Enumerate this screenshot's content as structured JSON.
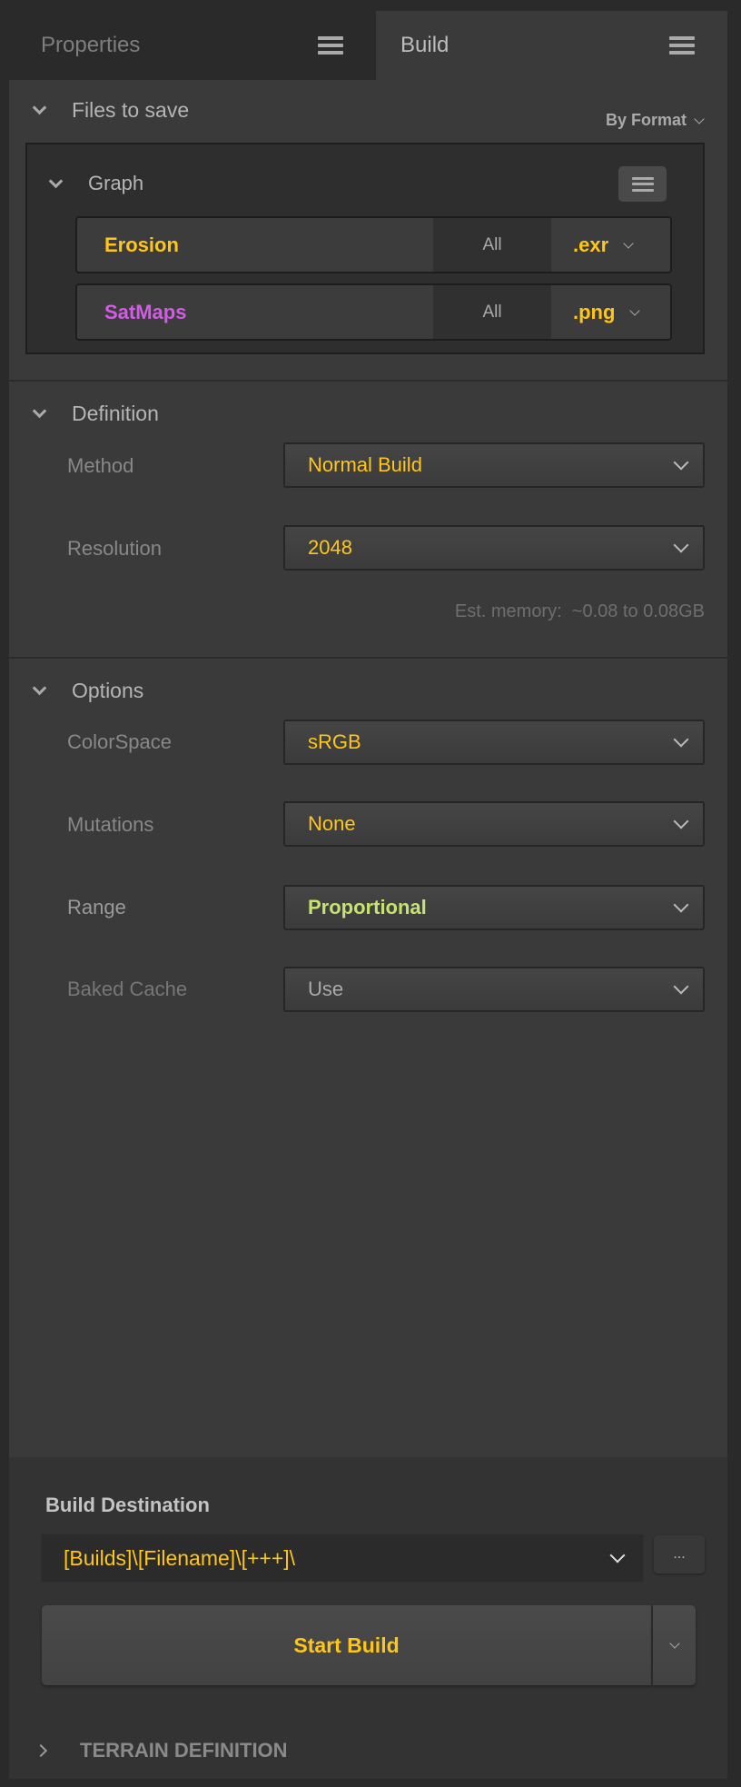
{
  "tabs": [
    {
      "label": "Properties",
      "active": false
    },
    {
      "label": "Build",
      "active": true
    }
  ],
  "files_to_save": {
    "title": "Files to save",
    "group_mode": "By Format",
    "group": {
      "title": "Graph",
      "files": [
        {
          "name": "Erosion",
          "color": "#ffc619",
          "selection": "All",
          "format": ".exr"
        },
        {
          "name": "SatMaps",
          "color": "#d35be6",
          "selection": "All",
          "format": ".png"
        }
      ]
    }
  },
  "definition": {
    "title": "Definition",
    "method": {
      "label": "Method",
      "value": "Normal Build"
    },
    "resolution": {
      "label": "Resolution",
      "value": "2048"
    },
    "memory": "Est. memory:  ~0.08 to 0.08GB"
  },
  "options": {
    "title": "Options",
    "colorspace": {
      "label": "ColorSpace",
      "value": "sRGB"
    },
    "mutations": {
      "label": "Mutations",
      "value": "None"
    },
    "range": {
      "label": "Range",
      "value": "Proportional"
    },
    "baked_cache": {
      "label": "Baked Cache",
      "value": "Use"
    }
  },
  "destination": {
    "label": "Build Destination",
    "path": "[Builds]\\[Filename]\\[+++]\\",
    "browse": "..."
  },
  "start_build": "Start Build",
  "terrain_definition": "TERRAIN DEFINITION",
  "colors": {
    "accent": "#ffc619",
    "magenta": "#d35be6",
    "green": "#c6e36f"
  }
}
